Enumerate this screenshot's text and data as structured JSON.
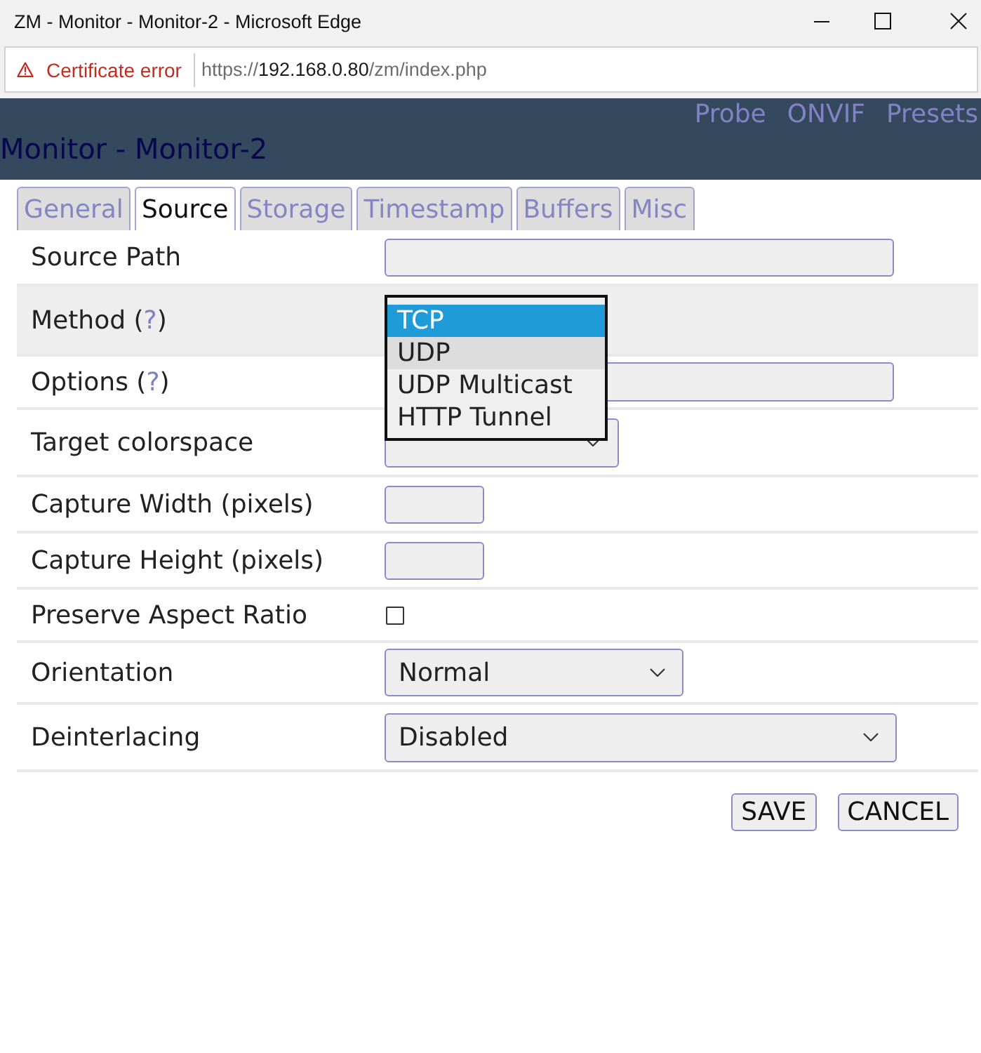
{
  "window": {
    "title": "ZM - Monitor - Monitor-2 - Microsoft Edge"
  },
  "address_bar": {
    "security_warning": "Certificate error",
    "url": {
      "scheme": "https://",
      "host": "192.168.0.80",
      "path": "/zm/index.php"
    }
  },
  "header": {
    "links": [
      "Probe",
      "ONVIF",
      "Presets"
    ],
    "title": "Monitor - Monitor-2"
  },
  "tabs": [
    {
      "label": "General",
      "selected": false
    },
    {
      "label": "Source",
      "selected": true
    },
    {
      "label": "Storage",
      "selected": false
    },
    {
      "label": "Timestamp",
      "selected": false
    },
    {
      "label": "Buffers",
      "selected": false
    },
    {
      "label": "Misc",
      "selected": false
    }
  ],
  "form": {
    "rows": [
      {
        "kind": "text",
        "label": "Source Path",
        "highlighted": false
      },
      {
        "kind": "select_open",
        "label": "Method (",
        "help_link": "?",
        "label_after": ")",
        "highlighted": true,
        "options": [
          {
            "label": "TCP",
            "selected": true,
            "hovered": false
          },
          {
            "label": "UDP",
            "selected": false,
            "hovered": true
          },
          {
            "label": "UDP Multicast",
            "selected": false,
            "hovered": false
          },
          {
            "label": "HTTP Tunnel",
            "selected": false,
            "hovered": false
          }
        ]
      },
      {
        "kind": "text",
        "label": "Options (",
        "help_link": "?",
        "label_after": ")",
        "highlighted": false
      },
      {
        "kind": "select",
        "label": "Target colorspace",
        "highlighted": false
      },
      {
        "kind": "number",
        "label": "Capture Width (pixels)",
        "highlighted": false
      },
      {
        "kind": "number",
        "label": "Capture Height (pixels)",
        "highlighted": false
      },
      {
        "kind": "checkbox",
        "label": "Preserve Aspect Ratio",
        "checked": false,
        "highlighted": false
      },
      {
        "kind": "select",
        "label": "Orientation",
        "value": "Normal",
        "highlighted": false
      },
      {
        "kind": "select",
        "label": "Deinterlacing",
        "value": "Disabled",
        "highlighted": false
      }
    ]
  },
  "buttons": [
    "SAVE",
    "CANCEL"
  ]
}
